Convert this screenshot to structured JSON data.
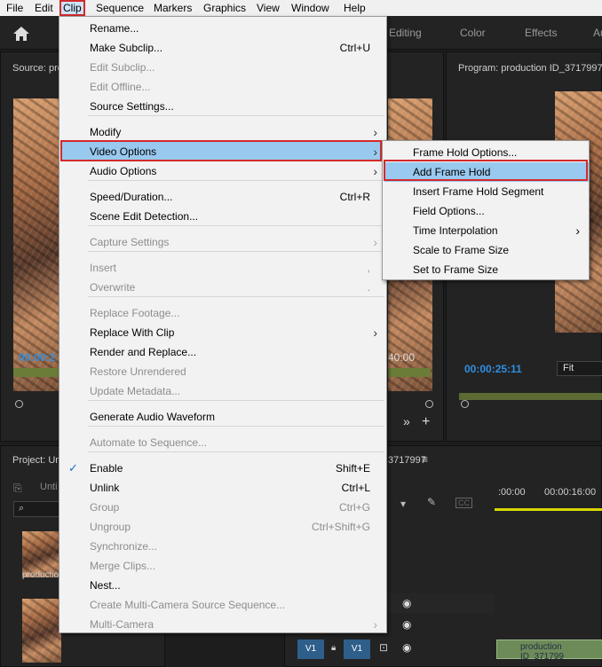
{
  "menubar": {
    "items": [
      "File",
      "Edit",
      "Clip",
      "Sequence",
      "Markers",
      "Graphics",
      "View",
      "Window",
      "Help"
    ]
  },
  "workspace": {
    "tabs": [
      "Editing",
      "Color",
      "Effects",
      "Au"
    ]
  },
  "source": {
    "title": "Source: prod",
    "timecode_left": "00:00:2",
    "timecode_right": "40:00"
  },
  "program": {
    "title": "Program: production ID_3717997",
    "timecode": "00:00:25:11",
    "fit": "Fit"
  },
  "project": {
    "title": "Project: Un",
    "bin": "Unti",
    "clip1": "production"
  },
  "timeline": {
    "title": "3717997",
    "ruler": [
      ":00:00",
      "00:00:16:00"
    ],
    "v1_a": "V1",
    "v1_b": "V1",
    "clip": "production ID_371799"
  },
  "clip_menu": {
    "items": [
      {
        "label": "Rename...",
        "shortcut": "",
        "dis": false
      },
      {
        "label": "Make Subclip...",
        "shortcut": "Ctrl+U",
        "dis": false
      },
      {
        "label": "Edit Subclip...",
        "shortcut": "",
        "dis": true
      },
      {
        "label": "Edit Offline...",
        "shortcut": "",
        "dis": true
      },
      {
        "label": "Source Settings...",
        "shortcut": "",
        "dis": false
      },
      {
        "label": "Modify",
        "shortcut": "",
        "dis": false,
        "sub": true
      },
      {
        "label": "Video Options",
        "shortcut": "",
        "dis": false,
        "sub": true,
        "hl": true
      },
      {
        "label": "Audio Options",
        "shortcut": "",
        "dis": false,
        "sub": true
      },
      {
        "label": "Speed/Duration...",
        "shortcut": "Ctrl+R",
        "dis": false
      },
      {
        "label": "Scene Edit Detection...",
        "shortcut": "",
        "dis": false
      },
      {
        "label": "Capture Settings",
        "shortcut": "",
        "dis": true,
        "sub": true
      },
      {
        "label": "Insert",
        "shortcut": ",",
        "dis": true
      },
      {
        "label": "Overwrite",
        "shortcut": ".",
        "dis": true
      },
      {
        "label": "Replace Footage...",
        "shortcut": "",
        "dis": true
      },
      {
        "label": "Replace With Clip",
        "shortcut": "",
        "dis": false,
        "sub": true
      },
      {
        "label": "Render and Replace...",
        "shortcut": "",
        "dis": false
      },
      {
        "label": "Restore Unrendered",
        "shortcut": "",
        "dis": true
      },
      {
        "label": "Update Metadata...",
        "shortcut": "",
        "dis": true
      },
      {
        "label": "Generate Audio Waveform",
        "shortcut": "",
        "dis": false
      },
      {
        "label": "Automate to Sequence...",
        "shortcut": "",
        "dis": true
      },
      {
        "label": "Enable",
        "shortcut": "Shift+E",
        "dis": false,
        "check": true
      },
      {
        "label": "Unlink",
        "shortcut": "Ctrl+L",
        "dis": false
      },
      {
        "label": "Group",
        "shortcut": "Ctrl+G",
        "dis": true
      },
      {
        "label": "Ungroup",
        "shortcut": "Ctrl+Shift+G",
        "dis": true
      },
      {
        "label": "Synchronize...",
        "shortcut": "",
        "dis": true
      },
      {
        "label": "Merge Clips...",
        "shortcut": "",
        "dis": true
      },
      {
        "label": "Nest...",
        "shortcut": "",
        "dis": false
      },
      {
        "label": "Create Multi-Camera Source Sequence...",
        "shortcut": "",
        "dis": true
      },
      {
        "label": "Multi-Camera",
        "shortcut": "",
        "dis": true,
        "sub": true
      }
    ]
  },
  "video_options_menu": {
    "items": [
      {
        "label": "Frame Hold Options...",
        "sub": false
      },
      {
        "label": "Add Frame Hold",
        "sub": false,
        "hl": true
      },
      {
        "label": "Insert Frame Hold Segment",
        "sub": false
      },
      {
        "label": "Field Options...",
        "sub": false
      },
      {
        "label": "Time Interpolation",
        "sub": true
      },
      {
        "label": "Scale to Frame Size",
        "sub": false
      },
      {
        "label": "Set to Frame Size",
        "sub": false
      }
    ]
  },
  "colors": {
    "highlight": "#99c9ef",
    "annotation": "#d42a2a",
    "timecode": "#2f8fe0"
  }
}
